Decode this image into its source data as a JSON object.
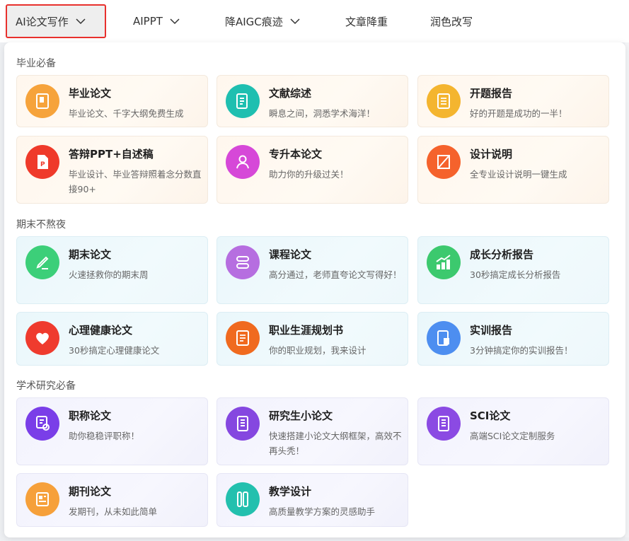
{
  "nav": {
    "items": [
      {
        "label": "AI论文写作",
        "has_dropdown": true,
        "active": true
      },
      {
        "label": "AIPPT",
        "has_dropdown": true
      },
      {
        "label": "降AIGC痕迹",
        "has_dropdown": true
      },
      {
        "label": "文章降重",
        "has_dropdown": false
      },
      {
        "label": "润色改写",
        "has_dropdown": false
      }
    ]
  },
  "sections": [
    {
      "title": "毕业必备",
      "theme": "warm",
      "cards": [
        {
          "title": "毕业论文",
          "desc": "毕业论文、千字大纲免费生成",
          "icon": "book-icon",
          "color": "#f6a33b"
        },
        {
          "title": "文献综述",
          "desc": "瞬息之间，洞悉学术海洋！",
          "icon": "document-list-icon",
          "color": "#1fbfb0"
        },
        {
          "title": "开题报告",
          "desc": "好的开题是成功的一半！",
          "icon": "report-icon",
          "color": "#f4b52f"
        },
        {
          "title": "答辩PPT+自述稿",
          "desc": "毕业设计、毕业答辩照着念分数直接90+",
          "icon": "ppt-file-icon",
          "color": "#ef3a2a"
        },
        {
          "title": "专升本论文",
          "desc": "助力你的升级过关！",
          "icon": "student-icon",
          "color": "#d648d8"
        },
        {
          "title": "设计说明",
          "desc": "全专业设计说明一键生成",
          "icon": "ruler-icon",
          "color": "#f5622c"
        }
      ]
    },
    {
      "title": "期末不熬夜",
      "theme": "cool",
      "cards": [
        {
          "title": "期末论文",
          "desc": "火速拯救你的期末周",
          "icon": "pencil-icon",
          "color": "#3ccf79"
        },
        {
          "title": "课程论文",
          "desc": "高分通过，老师直夸论文写得好！",
          "icon": "course-icon",
          "color": "#b66ee0"
        },
        {
          "title": "成长分析报告",
          "desc": "30秒搞定成长分析报告",
          "icon": "growth-chart-icon",
          "color": "#3cc96e"
        },
        {
          "title": "心理健康论文",
          "desc": "30秒搞定心理健康论文",
          "icon": "heart-icon",
          "color": "#ef3b2e"
        },
        {
          "title": "职业生涯规划书",
          "desc": "你的职业规划，我来设计",
          "icon": "career-icon",
          "color": "#f06a1f"
        },
        {
          "title": "实训报告",
          "desc": "3分钟搞定你的实训报告！",
          "icon": "training-report-icon",
          "color": "#4d8ef0"
        }
      ]
    },
    {
      "title": "学术研究必备",
      "theme": "lav",
      "cards": [
        {
          "title": "职称论文",
          "desc": "助你稳稳评职称！",
          "icon": "certificate-icon",
          "color": "#7a3ee8"
        },
        {
          "title": "研究生小论文",
          "desc": "快速搭建小论文大纲框架，高效不再头秃！",
          "icon": "paper-icon",
          "color": "#8547e0"
        },
        {
          "title": "SCI论文",
          "desc": "高端SCI论文定制服务",
          "icon": "sci-paper-icon",
          "color": "#8b4ae3"
        },
        {
          "title": "期刊论文",
          "desc": "发期刊，从未如此简单",
          "icon": "journal-icon",
          "color": "#f6a03a"
        },
        {
          "title": "教学设计",
          "desc": "高质量教学方案的灵感助手",
          "icon": "teaching-icon",
          "color": "#23c0ae"
        }
      ]
    }
  ]
}
